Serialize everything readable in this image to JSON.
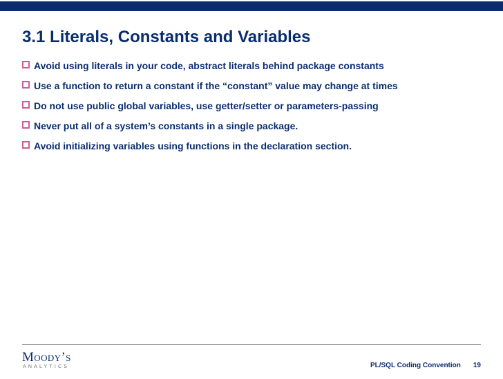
{
  "title": "3.1 Literals, Constants and Variables",
  "bullets": [
    "Avoid using literals in your code, abstract literals behind package constants",
    "Use a function to return a constant if the “constant” value may change at times",
    "Do not use public global variables, use getter/setter or parameters-passing",
    "Never put all of a system’s constants in a single package.",
    "Avoid initializing variables using functions in the declaration section."
  ],
  "footer": {
    "logo_main": "Moody’s",
    "logo_sub": "ANALYTICS",
    "doc_title": "PL/SQL Coding Convention",
    "page": "19"
  }
}
